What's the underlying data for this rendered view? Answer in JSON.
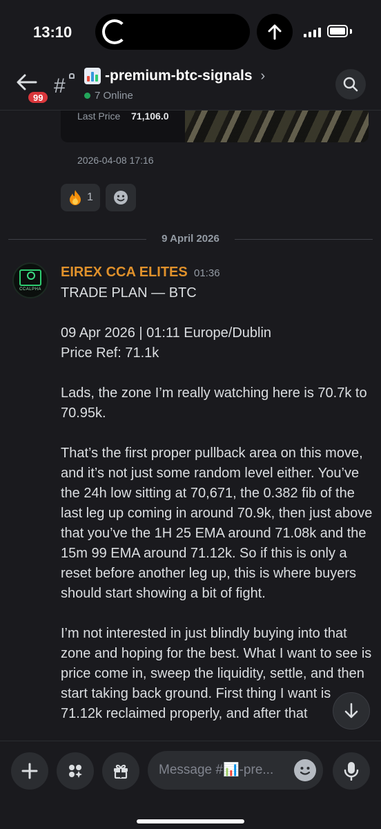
{
  "status_bar": {
    "time": "13:10",
    "icons": [
      "activity-ring-icon",
      "upload-arrow-icon",
      "cellular-signal-icon",
      "battery-icon"
    ]
  },
  "header": {
    "back_badge": "99",
    "channel_name": "-premium-btc-signals",
    "channel_emoji": "bar-chart-emoji",
    "online_text": "7 Online",
    "icons": [
      "back-arrow-icon",
      "locked-hash-icon",
      "chevron-right-icon",
      "search-icon"
    ]
  },
  "previous_message": {
    "embed_label": "Last Price",
    "embed_value": "71,106.0",
    "timestamp": "2026-04-08 17:16",
    "reactions": [
      {
        "emoji": "fire",
        "count": "1"
      }
    ]
  },
  "date_divider": "9 April 2026",
  "message": {
    "author": "EIREX CCA ELITES",
    "author_color": "#e0912b",
    "time": "01:36",
    "avatar_text": "CCALPHA",
    "paragraphs": [
      "TRADE PLAN — BTC",
      "",
      "09 Apr 2026 | 01:11 Europe/Dublin",
      "Price Ref: 71.1k",
      "",
      "Lads, the zone I’m really watching here is 70.7k to 70.95k.",
      "",
      "That’s the first proper pullback area on this move, and it’s not just some random level either. You’ve the 24h low sitting at 70,671, the 0.382 fib of the last leg up coming in around 70.9k, then just above that you’ve the 1H 25 EMA around 71.08k and the 15m 99 EMA around 71.12k. So if this is only a reset before another leg up, this is where buyers should start showing a bit of fight.",
      "",
      "I’m not interested in just blindly buying into that zone and hoping for the best. What I want to see is price come in, sweep the liquidity, settle, and then start taking back ground. First thing I want is 71.12k reclaimed properly, and after that"
    ]
  },
  "composer": {
    "placeholder": "Message #📊-pre...",
    "buttons": [
      "plus-icon",
      "apps-icon",
      "gift-icon",
      "emoji-icon",
      "microphone-icon"
    ]
  },
  "colors": {
    "background": "#1a1a1e",
    "online": "#23a55a",
    "badge": "#da373c"
  }
}
